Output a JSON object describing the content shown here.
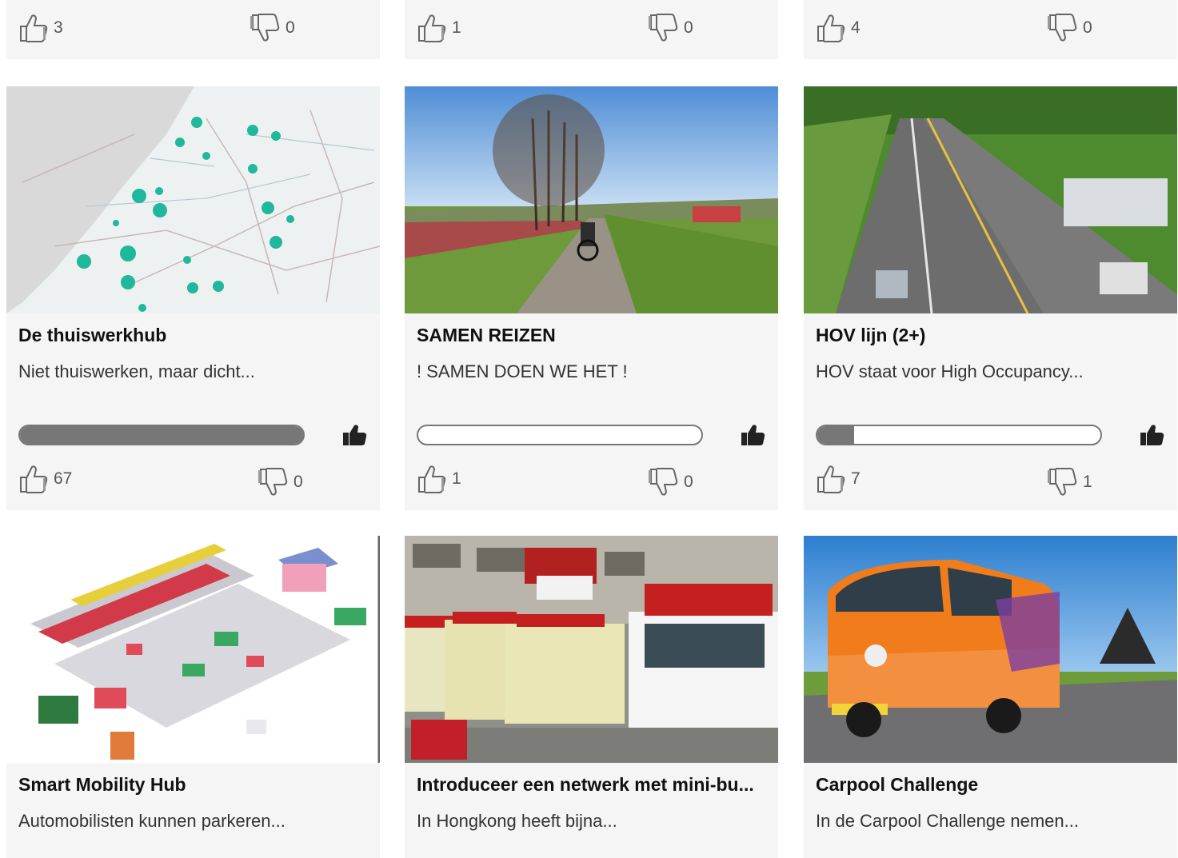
{
  "top_row": [
    {
      "up": "3",
      "down": "0"
    },
    {
      "up": "1",
      "down": "0"
    },
    {
      "up": "4",
      "down": "0"
    }
  ],
  "cards": [
    {
      "title": "De thuiswerkhub",
      "desc": "Niet thuiswerken, maar dicht...",
      "progress": 1.0,
      "up": "67",
      "down": "0"
    },
    {
      "title": "SAMEN REIZEN",
      "desc": "! SAMEN DOEN WE HET !",
      "progress": 0.0,
      "up": "1",
      "down": "0"
    },
    {
      "title": "HOV lijn (2+)",
      "desc": "HOV staat voor High Occupancy...",
      "progress": 0.13,
      "up": "7",
      "down": "1"
    },
    {
      "title": "Smart Mobility Hub",
      "desc": "Automobilisten kunnen parkeren..."
    },
    {
      "title": "Introduceer een netwerk met mini-bu...",
      "desc": "In Hongkong heeft bijna..."
    },
    {
      "title": "Carpool Challenge",
      "desc": "In de Carpool Challenge nemen..."
    }
  ],
  "icons": {
    "thumbs_up": "thumbs-up-icon",
    "thumbs_down": "thumbs-down-icon",
    "vote": "vote-hand-icon"
  },
  "colors": {
    "card_bg": "#f5f5f5",
    "bar": "#777777",
    "map_dot": "#1fb89a"
  }
}
